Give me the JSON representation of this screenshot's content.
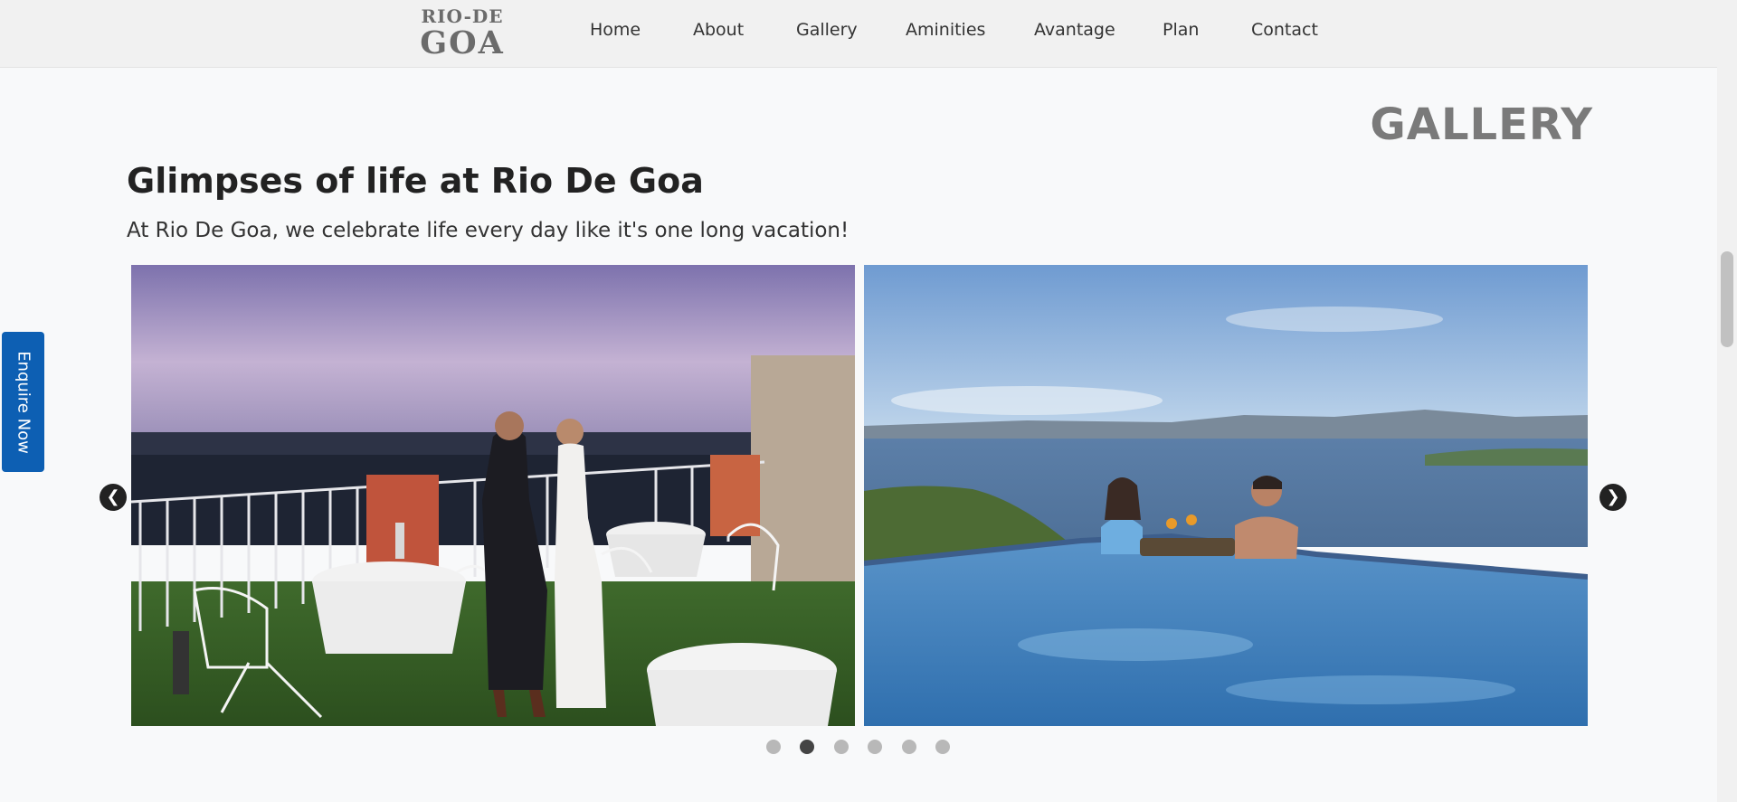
{
  "brand": {
    "logo_top": "RIO-DE",
    "logo_bottom": "GOA"
  },
  "nav": [
    {
      "label": "Home"
    },
    {
      "label": "About"
    },
    {
      "label": "Gallery"
    },
    {
      "label": "Aminities"
    },
    {
      "label": "Avantage"
    },
    {
      "label": "Plan"
    },
    {
      "label": "Contact"
    }
  ],
  "gallery": {
    "heading": "GALLERY",
    "title": "Glimpses of life at Rio De Goa",
    "subtitle": "At Rio De Goa, we celebrate life every day like it's one long vacation!",
    "prev_glyph": "❮",
    "next_glyph": "❯",
    "slide_count": 6,
    "active_slide": 2
  },
  "enquire": {
    "label": "Enquire Now"
  },
  "colors": {
    "accent": "#0d5fb3",
    "heading_gray": "#7a7a7a"
  }
}
